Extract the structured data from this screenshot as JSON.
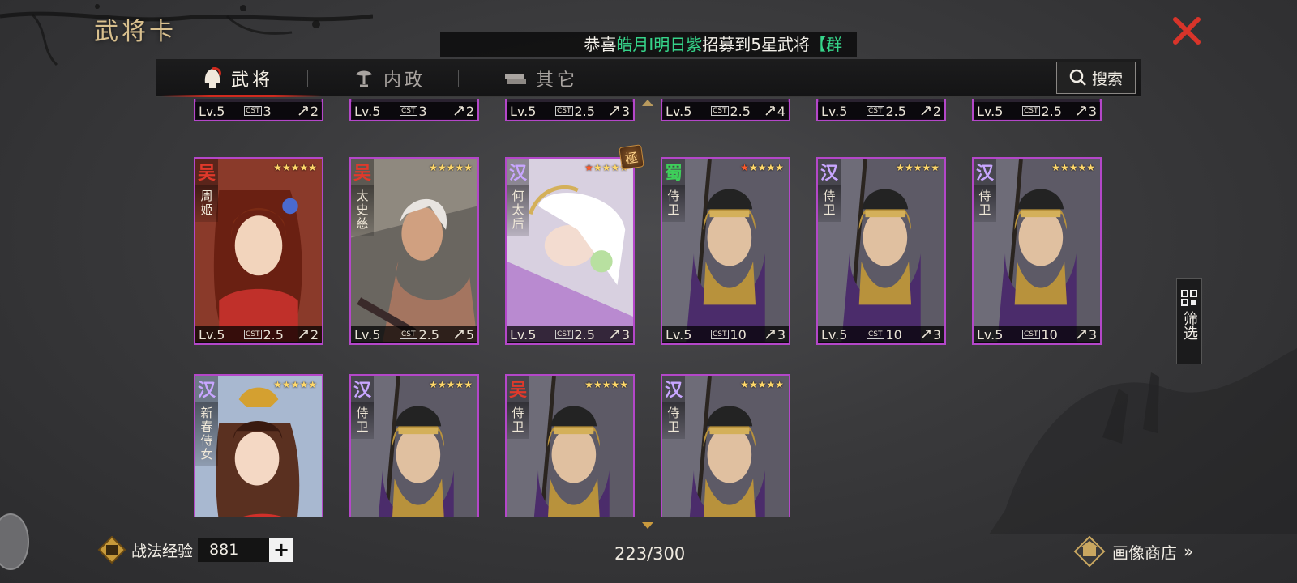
{
  "header": {
    "title": "武将卡",
    "marquee": {
      "prefix": "恭喜",
      "player": "皓月I明日紫",
      "middle": "招募到5星武将",
      "tail": "【群"
    },
    "close_icon": "close-x-icon"
  },
  "tabs": [
    {
      "label": "武将",
      "icon": "helmet-icon",
      "active": true
    },
    {
      "label": "内政",
      "icon": "bonsai-icon",
      "active": false
    },
    {
      "label": "其它",
      "icon": "book-stack-icon",
      "active": false
    }
  ],
  "search": {
    "label": "搜索",
    "icon": "search-icon"
  },
  "colors": {
    "wu": "#e0392b",
    "han": "#c8a6ff",
    "shu": "#3ecf5a",
    "card_border": "#b447c9",
    "accent_red": "#d02a1e"
  },
  "partial_row": [
    {
      "lv": "Lv.5",
      "cost": "3",
      "range": "2"
    },
    {
      "lv": "Lv.5",
      "cost": "3",
      "range": "2"
    },
    {
      "lv": "Lv.5",
      "cost": "2.5",
      "range": "3"
    },
    {
      "lv": "Lv.5",
      "cost": "2.5",
      "range": "4"
    },
    {
      "lv": "Lv.5",
      "cost": "2.5",
      "range": "2"
    },
    {
      "lv": "Lv.5",
      "cost": "2.5",
      "range": "3"
    }
  ],
  "cards": [
    {
      "faction": "吴",
      "name": "周姬",
      "stars": 5,
      "red_stars": 0,
      "lv": "Lv.5",
      "cost": "2.5",
      "range": "2",
      "art": "lady"
    },
    {
      "faction": "吴",
      "name": "太史慈",
      "stars": 5,
      "red_stars": 0,
      "lv": "Lv.5",
      "cost": "2.5",
      "range": "5",
      "art": "warrior"
    },
    {
      "faction": "汉",
      "name": "何太后",
      "stars": 5,
      "red_stars": 1,
      "lv": "Lv.5",
      "cost": "2.5",
      "range": "3",
      "art": "empress",
      "badge": "極"
    },
    {
      "faction": "蜀",
      "name": "侍卫",
      "stars": 5,
      "red_stars": 1,
      "lv": "Lv.5",
      "cost": "10",
      "range": "3",
      "art": "guard"
    },
    {
      "faction": "汉",
      "name": "侍卫",
      "stars": 5,
      "red_stars": 0,
      "lv": "Lv.5",
      "cost": "10",
      "range": "3",
      "art": "guard"
    },
    {
      "faction": "汉",
      "name": "侍卫",
      "stars": 5,
      "red_stars": 0,
      "lv": "Lv.5",
      "cost": "10",
      "range": "3",
      "art": "guard"
    },
    {
      "faction": "汉",
      "name": "新春侍女",
      "stars": 5,
      "red_stars": 0,
      "lv": "",
      "cost": "",
      "range": "",
      "art": "maid"
    },
    {
      "faction": "汉",
      "name": "侍卫",
      "stars": 5,
      "red_stars": 0,
      "lv": "",
      "cost": "",
      "range": "",
      "art": "guard"
    },
    {
      "faction": "吴",
      "name": "侍卫",
      "stars": 5,
      "red_stars": 0,
      "lv": "",
      "cost": "",
      "range": "",
      "art": "guard"
    },
    {
      "faction": "汉",
      "name": "侍卫",
      "stars": 5,
      "red_stars": 0,
      "lv": "",
      "cost": "",
      "range": "",
      "art": "guard"
    }
  ],
  "cost_tag": "CST",
  "filter": {
    "label": "筛选",
    "icon": "grid-filter-icon"
  },
  "footer": {
    "exp_label": "战法经验",
    "exp_value": "881",
    "plus": "+",
    "count": "223/300",
    "shop_label": "画像商店",
    "shop_arrow": "»"
  }
}
